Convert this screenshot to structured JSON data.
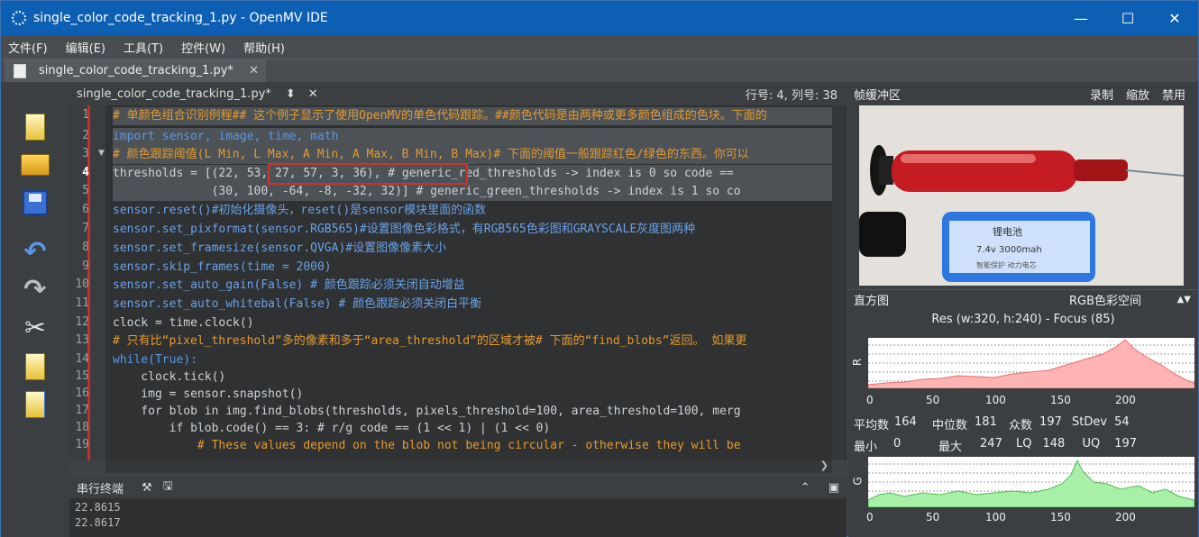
{
  "window": {
    "title": "single_color_code_tracking_1.py - OpenMV IDE"
  },
  "menu": [
    "文件(F)",
    "编辑(E)",
    "工具(T)",
    "控件(W)",
    "帮助(H)"
  ],
  "tab": {
    "label": "single_color_code_tracking_1.py*"
  },
  "editor": {
    "filename": "single_color_code_tracking_1.py*",
    "position": "行号: 4, 列号: 38"
  },
  "gutter": [
    "1",
    "2",
    "3",
    "4",
    "5",
    "6",
    "7",
    "8",
    "9",
    "10",
    "11",
    "12",
    "13",
    "14",
    "15",
    "16",
    "17",
    "18",
    "19"
  ],
  "code": [
    "# 单颜色组合识别例程## 这个例子显示了使用OpenMV的单色代码跟踪。##颜色代码是由两种或更多颜色组成的色块。下面的",
    "import sensor, image, time, math",
    "# 颜色跟踪阈值(L Min, L Max, A Min, A Max, B Min, B Max)# 下面的阈值一般跟踪红色/绿色的东西。你可以",
    "thresholds = [(22, 53, 27, 57, 3, 36), # generic_red_thresholds -> index is 0 so code ==",
    "              (30, 100, -64, -8, -32, 32)] # generic_green_thresholds -> index is 1 so co",
    "sensor.reset()#初始化摄像头，reset()是sensor模块里面的函数",
    "sensor.set_pixformat(sensor.RGB565)#设置图像色彩格式，有RGB565色彩图和GRAYSCALE灰度图两种",
    "sensor.set_framesize(sensor.QVGA)#设置图像像素大小",
    "sensor.skip_frames(time = 2000)",
    "sensor.set_auto_gain(False) # 颜色跟踪必须关闭自动增益",
    "sensor.set_auto_whitebal(False) # 颜色跟踪必须关闭白平衡",
    "clock = time.clock()",
    "# 只有比“pixel_threshold”多的像素和多于“area_threshold”的区域才被# 下面的“find_blobs”返回。 如果更",
    "while(True):",
    "    clock.tick()",
    "    img = sensor.snapshot()",
    "    for blob in img.find_blobs(thresholds, pixels_threshold=100, area_threshold=100, merg",
    "        if blob.code() == 3: # r/g code == (1 << 1) | (1 << 0)",
    "            # These values depend on the blob not being circular - otherwise they will be"
  ],
  "serial": {
    "title": "串行终端",
    "lines": [
      "22.8615",
      "22.8617"
    ]
  },
  "framebuffer": {
    "title": "帧缓冲区",
    "record": "录制",
    "zoom": "缩放",
    "disable": "禁用",
    "battery_label": "锂电池",
    "battery_spec": "7.4v 3000mah",
    "battery_sub": "智能保护 动力电芯"
  },
  "histogram": {
    "title": "直方图",
    "colorspace": "RGB色彩空间",
    "resolution": "Res (w:320, h:240) - Focus (85)",
    "ticks": [
      "0",
      "50",
      "100",
      "150",
      "200"
    ],
    "r": {
      "label": "R",
      "mean": "164",
      "median": "181",
      "mode": "197",
      "stdev": "54",
      "min": "0",
      "max": "247",
      "lq": "148",
      "uq": "197"
    },
    "g": {
      "label": "G"
    },
    "stat_labels": {
      "mean": "平均数",
      "median": "中位数",
      "mode": "众数",
      "stdev": "StDev",
      "min": "最小",
      "max": "最大",
      "lq": "LQ",
      "uq": "UQ"
    },
    "colors": {
      "r_fill": "#ffb3b3",
      "g_fill": "#a8f0a8"
    }
  }
}
